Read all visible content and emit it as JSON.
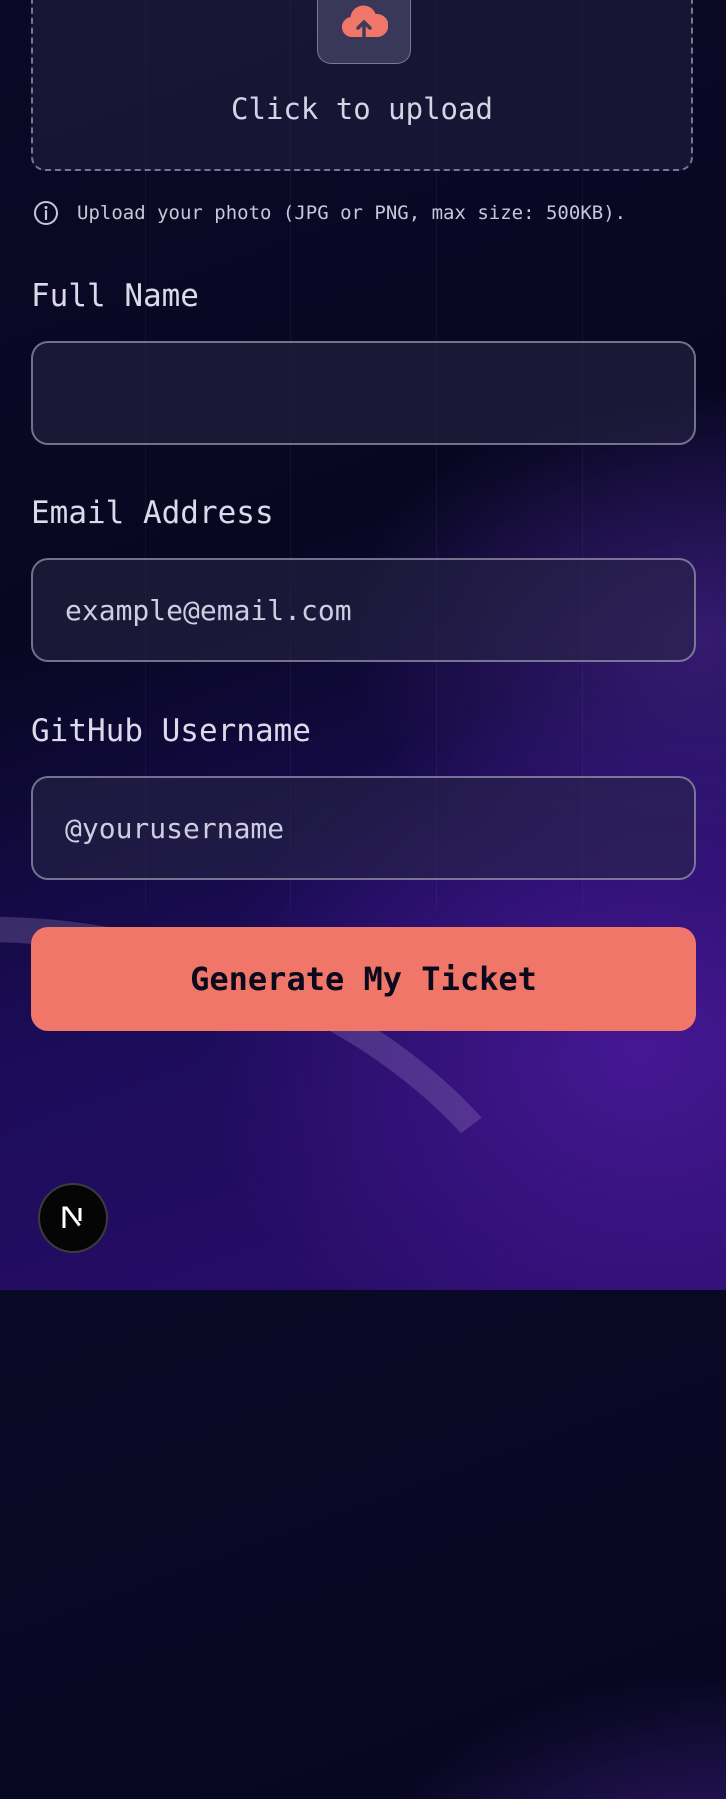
{
  "upload": {
    "label": "Click to upload",
    "icon": "cloud-upload-icon"
  },
  "hint": {
    "text": "Upload your photo (JPG or PNG, max size: 500KB).",
    "icon": "info-icon"
  },
  "form": {
    "full_name": {
      "label": "Full Name",
      "value": "",
      "placeholder": ""
    },
    "email": {
      "label": "Email Address",
      "value": "",
      "placeholder": "example@email.com"
    },
    "github": {
      "label": "GitHub Username",
      "value": "",
      "placeholder": "@yourusername"
    },
    "submit_label": "Generate My Ticket"
  },
  "badge": {
    "letter": "N",
    "icon": "nextjs-icon"
  },
  "colors": {
    "accent": "#f1766a",
    "background_dark": "#080722",
    "background_purple": "#2c0d6e"
  }
}
